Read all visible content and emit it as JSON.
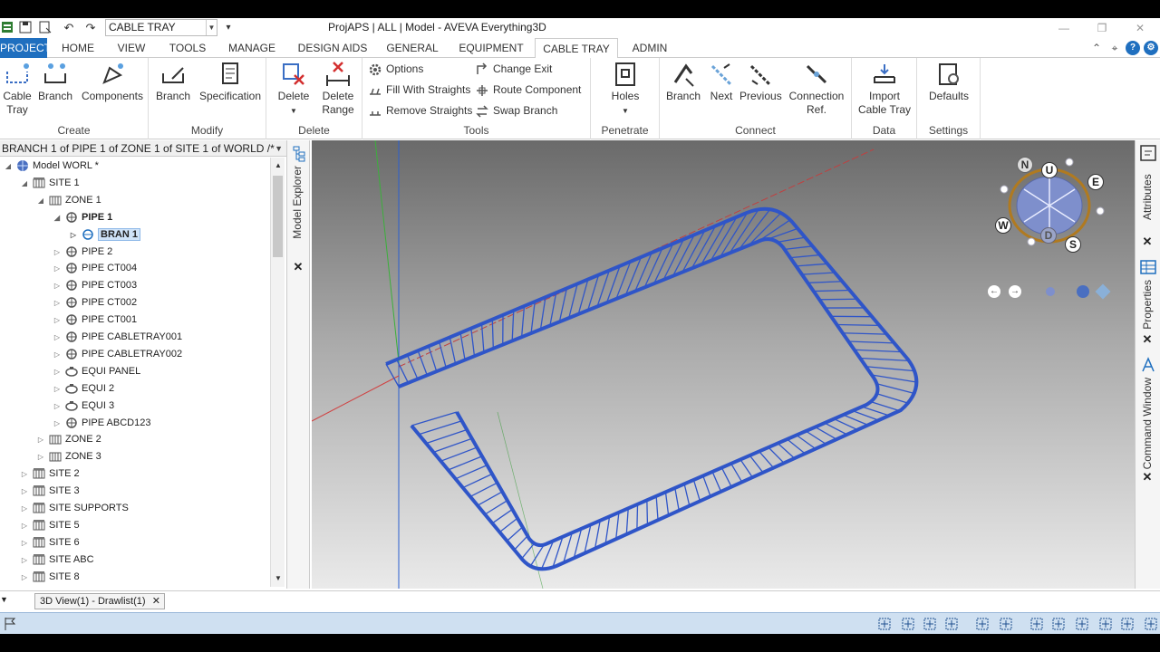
{
  "window": {
    "title": "ProjAPS | ALL | Model - AVEVA Everything3D",
    "module_combo": "CABLE TRAY"
  },
  "tabs": [
    {
      "label": "PROJECT"
    },
    {
      "label": "HOME"
    },
    {
      "label": "VIEW"
    },
    {
      "label": "TOOLS"
    },
    {
      "label": "MANAGE"
    },
    {
      "label": "DESIGN AIDS"
    },
    {
      "label": "GENERAL"
    },
    {
      "label": "EQUIPMENT"
    },
    {
      "label": "CABLE TRAY"
    },
    {
      "label": "ADMIN"
    }
  ],
  "active_tab": "CABLE TRAY",
  "ribbon": {
    "create": {
      "label": "Create",
      "cable_tray_1": "Cable",
      "cable_tray_2": "Tray",
      "branch": "Branch",
      "components": "Components"
    },
    "modify": {
      "label": "Modify",
      "branch": "Branch",
      "specification": "Specification"
    },
    "delete": {
      "label": "Delete",
      "delete": "Delete",
      "delete_range_1": "Delete",
      "delete_range_2": "Range"
    },
    "tools": {
      "label": "Tools",
      "options": "Options",
      "fill": "Fill With Straights",
      "remove": "Remove Straights",
      "change_exit": "Change Exit",
      "route": "Route Component",
      "swap": "Swap Branch"
    },
    "penetrate": {
      "label": "Penetrate",
      "holes": "Holes"
    },
    "connect": {
      "label": "Connect",
      "branch": "Branch",
      "next": "Next",
      "previous": "Previous",
      "conn_1": "Connection",
      "conn_2": "Ref."
    },
    "data": {
      "label": "Data",
      "import_1": "Import",
      "import_2": "Cable Tray"
    },
    "settings": {
      "label": "Settings",
      "defaults": "Defaults"
    }
  },
  "explorer": {
    "breadcrumb": "BRANCH 1 of PIPE 1 of ZONE 1 of SITE 1 of WORLD /*",
    "panel_title": "Model Explorer",
    "tree": [
      {
        "label": "Model WORL *"
      },
      {
        "label": "SITE 1"
      },
      {
        "label": "ZONE 1"
      },
      {
        "label": "PIPE 1"
      },
      {
        "label": "BRAN 1"
      },
      {
        "label": "PIPE 2"
      },
      {
        "label": "PIPE CT004"
      },
      {
        "label": "PIPE CT003"
      },
      {
        "label": "PIPE CT002"
      },
      {
        "label": "PIPE CT001"
      },
      {
        "label": "PIPE CABLETRAY001"
      },
      {
        "label": "PIPE CABLETRAY002"
      },
      {
        "label": "EQUI PANEL"
      },
      {
        "label": "EQUI 2"
      },
      {
        "label": "EQUI 3"
      },
      {
        "label": "PIPE ABCD123"
      },
      {
        "label": "ZONE 2"
      },
      {
        "label": "ZONE 3"
      },
      {
        "label": "SITE 2"
      },
      {
        "label": "SITE 3"
      },
      {
        "label": "SITE SUPPORTS"
      },
      {
        "label": "SITE 5"
      },
      {
        "label": "SITE 6"
      },
      {
        "label": "SITE ABC"
      },
      {
        "label": "SITE 8"
      }
    ]
  },
  "compass": {
    "n": "N",
    "u": "U",
    "e": "E",
    "w": "W",
    "d": "D",
    "s": "S"
  },
  "right_dock": {
    "attributes": "Attributes",
    "properties": "Properties",
    "command_window": "Command Window"
  },
  "doc_tab": "3D View(1) - Drawlist(1)",
  "colors": {
    "accent": "#1f6fbf",
    "tray": "#2f55c8",
    "statusbar": "#cfe0f1"
  }
}
